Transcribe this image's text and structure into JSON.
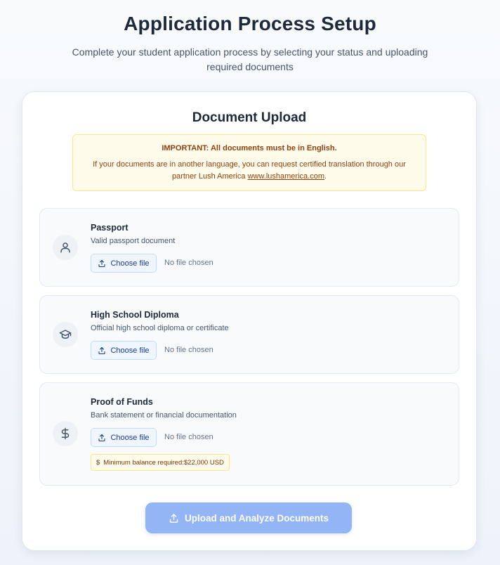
{
  "header": {
    "title": "Application Process Setup",
    "subtitle": "Complete your student application process by selecting your status and uploading required documents"
  },
  "card": {
    "title": "Document Upload",
    "notice": {
      "title": "IMPORTANT: All documents must be in English.",
      "body_prefix": "If your documents are in another language, you can request certified translation through our partner Lush America ",
      "link_text": "www.lushamerica.com",
      "body_suffix": "."
    },
    "documents": [
      {
        "name": "Passport",
        "description": "Valid passport document",
        "icon": "user-icon",
        "choose_label": "Choose file",
        "file_status": "No file chosen"
      },
      {
        "name": "High School Diploma",
        "description": "Official high school diploma or certificate",
        "icon": "graduation-cap-icon",
        "choose_label": "Choose file",
        "file_status": "No file chosen"
      },
      {
        "name": "Proof of Funds",
        "description": "Bank statement or financial documentation",
        "icon": "dollar-sign-icon",
        "choose_label": "Choose file",
        "file_status": "No file chosen",
        "badge_icon": "$",
        "badge_text": "Minimum balance required:$22,000 USD"
      }
    ],
    "submit_label": "Upload and Analyze Documents"
  },
  "colors": {
    "accent_disabled": "#93b4f5",
    "notice_bg": "#fffbeb",
    "notice_text": "#92400e"
  }
}
